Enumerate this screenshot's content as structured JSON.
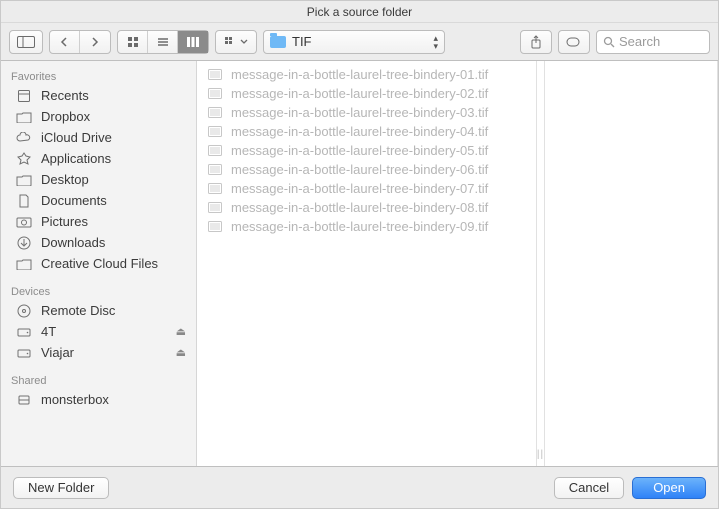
{
  "window_title": "Pick a source folder",
  "path_control": {
    "folder_name": "TIF"
  },
  "search": {
    "placeholder": "Search"
  },
  "sidebar": {
    "sections": [
      {
        "header": "Favorites",
        "items": [
          {
            "label": "Recents",
            "icon": "recents-icon"
          },
          {
            "label": "Dropbox",
            "icon": "folder-gray-icon"
          },
          {
            "label": "iCloud Drive",
            "icon": "cloud-icon"
          },
          {
            "label": "Applications",
            "icon": "applications-icon"
          },
          {
            "label": "Desktop",
            "icon": "desktop-icon"
          },
          {
            "label": "Documents",
            "icon": "documents-icon"
          },
          {
            "label": "Pictures",
            "icon": "pictures-icon"
          },
          {
            "label": "Downloads",
            "icon": "downloads-icon"
          },
          {
            "label": "Creative Cloud Files",
            "icon": "folder-gray-icon"
          }
        ]
      },
      {
        "header": "Devices",
        "items": [
          {
            "label": "Remote Disc",
            "icon": "disc-icon"
          },
          {
            "label": "4T",
            "icon": "drive-icon",
            "ejectable": true
          },
          {
            "label": "Viajar",
            "icon": "drive-icon",
            "ejectable": true
          }
        ]
      },
      {
        "header": "Shared",
        "items": [
          {
            "label": "monsterbox",
            "icon": "server-icon"
          }
        ]
      }
    ]
  },
  "files": [
    "message-in-a-bottle-laurel-tree-bindery-01.tif",
    "message-in-a-bottle-laurel-tree-bindery-02.tif",
    "message-in-a-bottle-laurel-tree-bindery-03.tif",
    "message-in-a-bottle-laurel-tree-bindery-04.tif",
    "message-in-a-bottle-laurel-tree-bindery-05.tif",
    "message-in-a-bottle-laurel-tree-bindery-06.tif",
    "message-in-a-bottle-laurel-tree-bindery-07.tif",
    "message-in-a-bottle-laurel-tree-bindery-08.tif",
    "message-in-a-bottle-laurel-tree-bindery-09.tif"
  ],
  "footer": {
    "new_folder": "New Folder",
    "cancel": "Cancel",
    "open": "Open"
  }
}
